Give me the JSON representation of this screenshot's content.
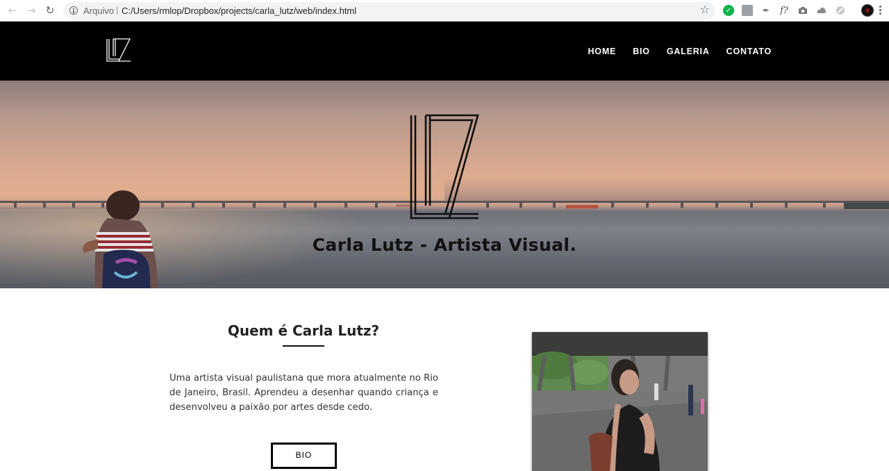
{
  "browser": {
    "origin_label": "Arquivo",
    "separator": "|",
    "url": "C:/Users/rmlop/Dropbox/projects/carla_lutz/web/index.html",
    "extensions": [
      "check-extension-icon",
      "pdf-extension-icon",
      "eyedropper-extension-icon",
      "font-extension-icon",
      "camera-extension-icon",
      "drive-extension-icon",
      "extension-icon"
    ],
    "font_ext_label": "f?"
  },
  "site": {
    "nav": [
      "HOME",
      "BIO",
      "GALERIA",
      "CONTATO"
    ],
    "hero_title": "Carla Lutz - Artista Visual."
  },
  "bio": {
    "title": "Quem é Carla Lutz?",
    "text": "Uma artista visual paulistana que mora atualmente no Rio de Janeiro, Brasil. Aprendeu a desenhar quando criança e desenvolveu a paixão por artes desde cedo.",
    "button_label": "BIO"
  },
  "colors": {
    "header_bg": "#000000",
    "nav_text": "#ffffff",
    "accent_green": "#0fb24a"
  }
}
